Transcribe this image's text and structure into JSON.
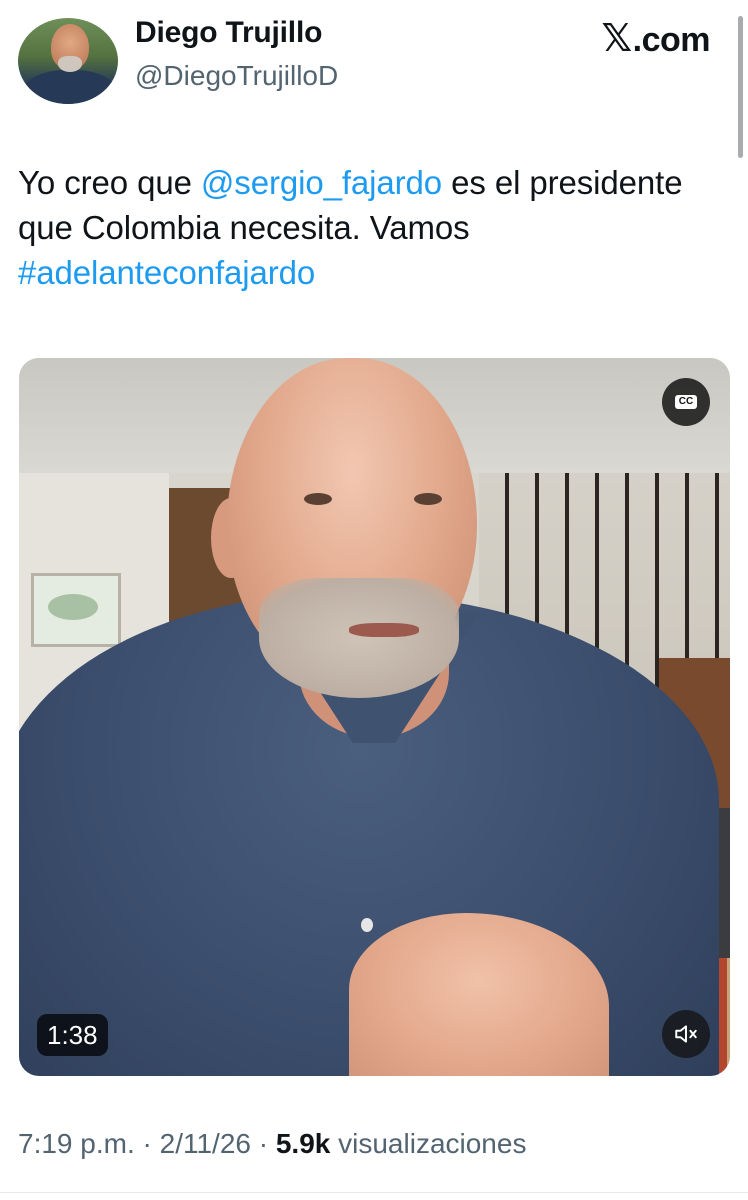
{
  "author": {
    "name": "Diego Trujillo",
    "handle": "@DiegoTrujilloD"
  },
  "brand": {
    "label": ".com",
    "icon": "x-logo-icon"
  },
  "tweet": {
    "text_before": "Yo creo que ",
    "mention": "@sergio_fajardo",
    "text_middle": " es el presidente que Colombia necesita. Vamos ",
    "hashtag": "#adelanteconfajardo"
  },
  "video": {
    "cc_label": "CC",
    "duration": "1:38",
    "mute_icon": "muted-speaker-icon"
  },
  "meta": {
    "time": "7:19 p.m.",
    "sep1": " · ",
    "date": "2/11/26",
    "sep2": " · ",
    "views_count": "5.9k",
    "views_label": " visualizaciones"
  },
  "colors": {
    "link": "#1d9bf0",
    "secondary_text": "#536471"
  }
}
